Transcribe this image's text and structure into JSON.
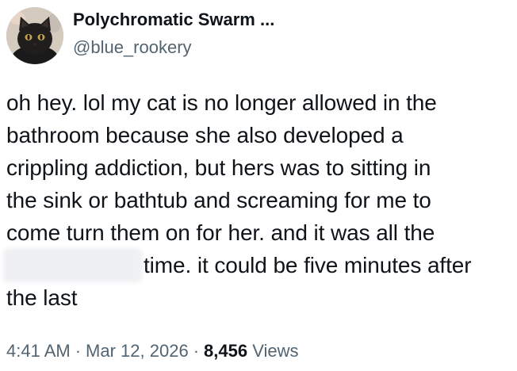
{
  "author": {
    "display_name": "Polychromatic Swarm ...",
    "handle": "@blue_rookery",
    "avatar_icon": "black-cat-avatar"
  },
  "tweet": {
    "lines": [
      "oh hey. lol my cat is no longer allowed in the",
      "bathroom because she also developed a",
      "crippling addiction, but hers was to sitting in",
      "the sink or bathtub and screaming for me to",
      "come turn them on for her. and it was all the"
    ],
    "redacted_line_rest": "time. it could be five minutes after",
    "last_line": "the last"
  },
  "meta": {
    "time": "4:41 AM",
    "separator": "·",
    "date": "Mar 12, 2026",
    "views_count": "8,456",
    "views_label": "Views"
  },
  "colors": {
    "text_primary": "#0f1419",
    "text_secondary": "#536471",
    "redaction_blur": "#eef0f2"
  }
}
